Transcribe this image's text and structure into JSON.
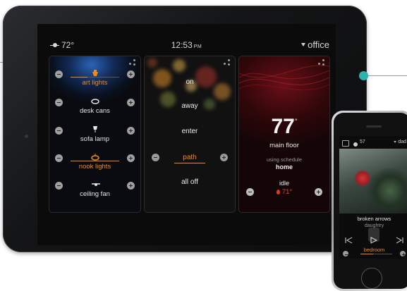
{
  "header": {
    "weather_icon": "sun-cloud-icon",
    "temperature": "72°",
    "time": "12:53",
    "ampm": "PM",
    "location": "office"
  },
  "lights": {
    "items": [
      {
        "label": "art lights",
        "icon": "spotlight-icon",
        "active": true,
        "level": 0.35
      },
      {
        "label": "desk cans",
        "icon": "can-light-icon",
        "active": false
      },
      {
        "label": "sofa lamp",
        "icon": "lamp-icon",
        "active": false
      },
      {
        "label": "nook lights",
        "icon": "pendant-light-icon",
        "active": true,
        "level": 1.0
      },
      {
        "label": "ceiling fan",
        "icon": "fan-icon",
        "active": false
      }
    ]
  },
  "modes": {
    "items": [
      {
        "label": "on",
        "active": false
      },
      {
        "label": "away",
        "active": false
      },
      {
        "label": "enter",
        "active": false
      },
      {
        "label": "path",
        "active": true
      },
      {
        "label": "all off",
        "active": false
      }
    ]
  },
  "thermostat": {
    "temperature": "77",
    "degree": "°",
    "zone": "main floor",
    "schedule_label": "using schedule",
    "schedule": "home",
    "status": "idle",
    "setpoint": "71°"
  },
  "phone": {
    "header": {
      "temperature": "57",
      "location": "dad"
    },
    "track": "broken arrows",
    "artist": "daughtry",
    "room": "bedroom",
    "volume": 0.4
  },
  "colors": {
    "accent": "#f08a1d",
    "callout": "#2fb3ad"
  }
}
